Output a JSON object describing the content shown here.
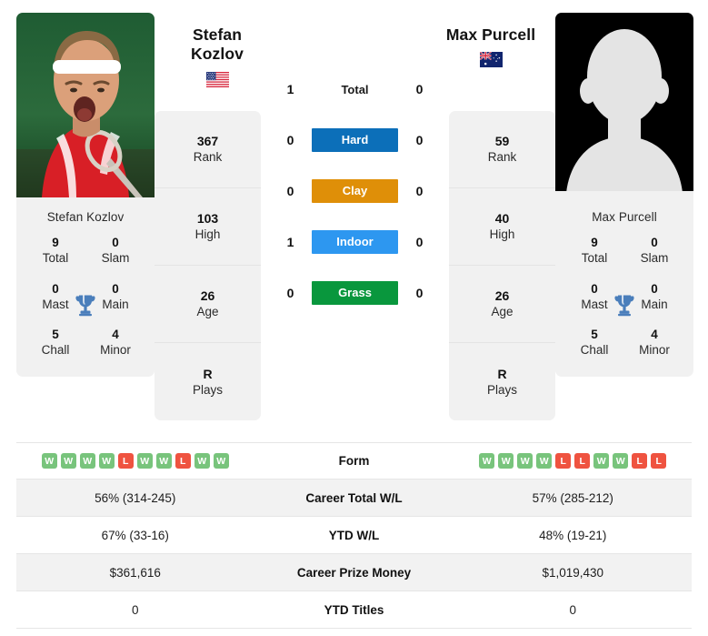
{
  "players": {
    "left": {
      "full_name": "Stefan Kozlov",
      "name_line1": "Stefan",
      "name_line2": "Kozlov",
      "country": "United States",
      "flag_icon": "flag-us",
      "photo_type": "player-photo",
      "info": [
        {
          "value": "367",
          "label": "Rank"
        },
        {
          "value": "103",
          "label": "High"
        },
        {
          "value": "26",
          "label": "Age"
        },
        {
          "value": "R",
          "label": "Plays"
        }
      ],
      "titles": [
        {
          "value": "9",
          "label": "Total"
        },
        {
          "value": "0",
          "label": "Slam"
        },
        {
          "value": "0",
          "label": "Mast"
        },
        {
          "value": "0",
          "label": "Main"
        },
        {
          "value": "5",
          "label": "Chall"
        },
        {
          "value": "4",
          "label": "Minor"
        }
      ],
      "form": [
        "W",
        "W",
        "W",
        "W",
        "L",
        "W",
        "W",
        "L",
        "W",
        "W"
      ]
    },
    "right": {
      "full_name": "Max Purcell",
      "name_line1": "Max Purcell",
      "name_line2": "",
      "country": "Australia",
      "flag_icon": "flag-au",
      "photo_type": "placeholder-silhouette",
      "info": [
        {
          "value": "59",
          "label": "Rank"
        },
        {
          "value": "40",
          "label": "High"
        },
        {
          "value": "26",
          "label": "Age"
        },
        {
          "value": "R",
          "label": "Plays"
        }
      ],
      "titles": [
        {
          "value": "9",
          "label": "Total"
        },
        {
          "value": "0",
          "label": "Slam"
        },
        {
          "value": "0",
          "label": "Mast"
        },
        {
          "value": "0",
          "label": "Main"
        },
        {
          "value": "5",
          "label": "Chall"
        },
        {
          "value": "4",
          "label": "Minor"
        }
      ],
      "form": [
        "W",
        "W",
        "W",
        "W",
        "L",
        "L",
        "W",
        "W",
        "L",
        "L"
      ]
    }
  },
  "head_to_head": [
    {
      "label": "Total",
      "left": "1",
      "right": "0",
      "style": "plain",
      "color": ""
    },
    {
      "label": "Hard",
      "left": "0",
      "right": "0",
      "style": "badge",
      "color": "#0c6fb9"
    },
    {
      "label": "Clay",
      "left": "0",
      "right": "0",
      "style": "badge",
      "color": "#df8f08"
    },
    {
      "label": "Indoor",
      "left": "1",
      "right": "0",
      "style": "badge",
      "color": "#2d97f0"
    },
    {
      "label": "Grass",
      "left": "0",
      "right": "0",
      "style": "badge",
      "color": "#09973d"
    }
  ],
  "stats_table": {
    "form_label": "Form",
    "rows": [
      {
        "label": "Career Total W/L",
        "left": "56% (314-245)",
        "right": "57% (285-212)"
      },
      {
        "label": "YTD W/L",
        "left": "67% (33-16)",
        "right": "48% (19-21)"
      },
      {
        "label": "Career Prize Money",
        "left": "$361,616",
        "right": "$1,019,430"
      },
      {
        "label": "YTD Titles",
        "left": "0",
        "right": "0"
      }
    ]
  },
  "colors": {
    "win": "#78c47c",
    "loss": "#ef5340",
    "card_bg": "#f1f1f1",
    "row_shade": "#f2f2f2"
  }
}
